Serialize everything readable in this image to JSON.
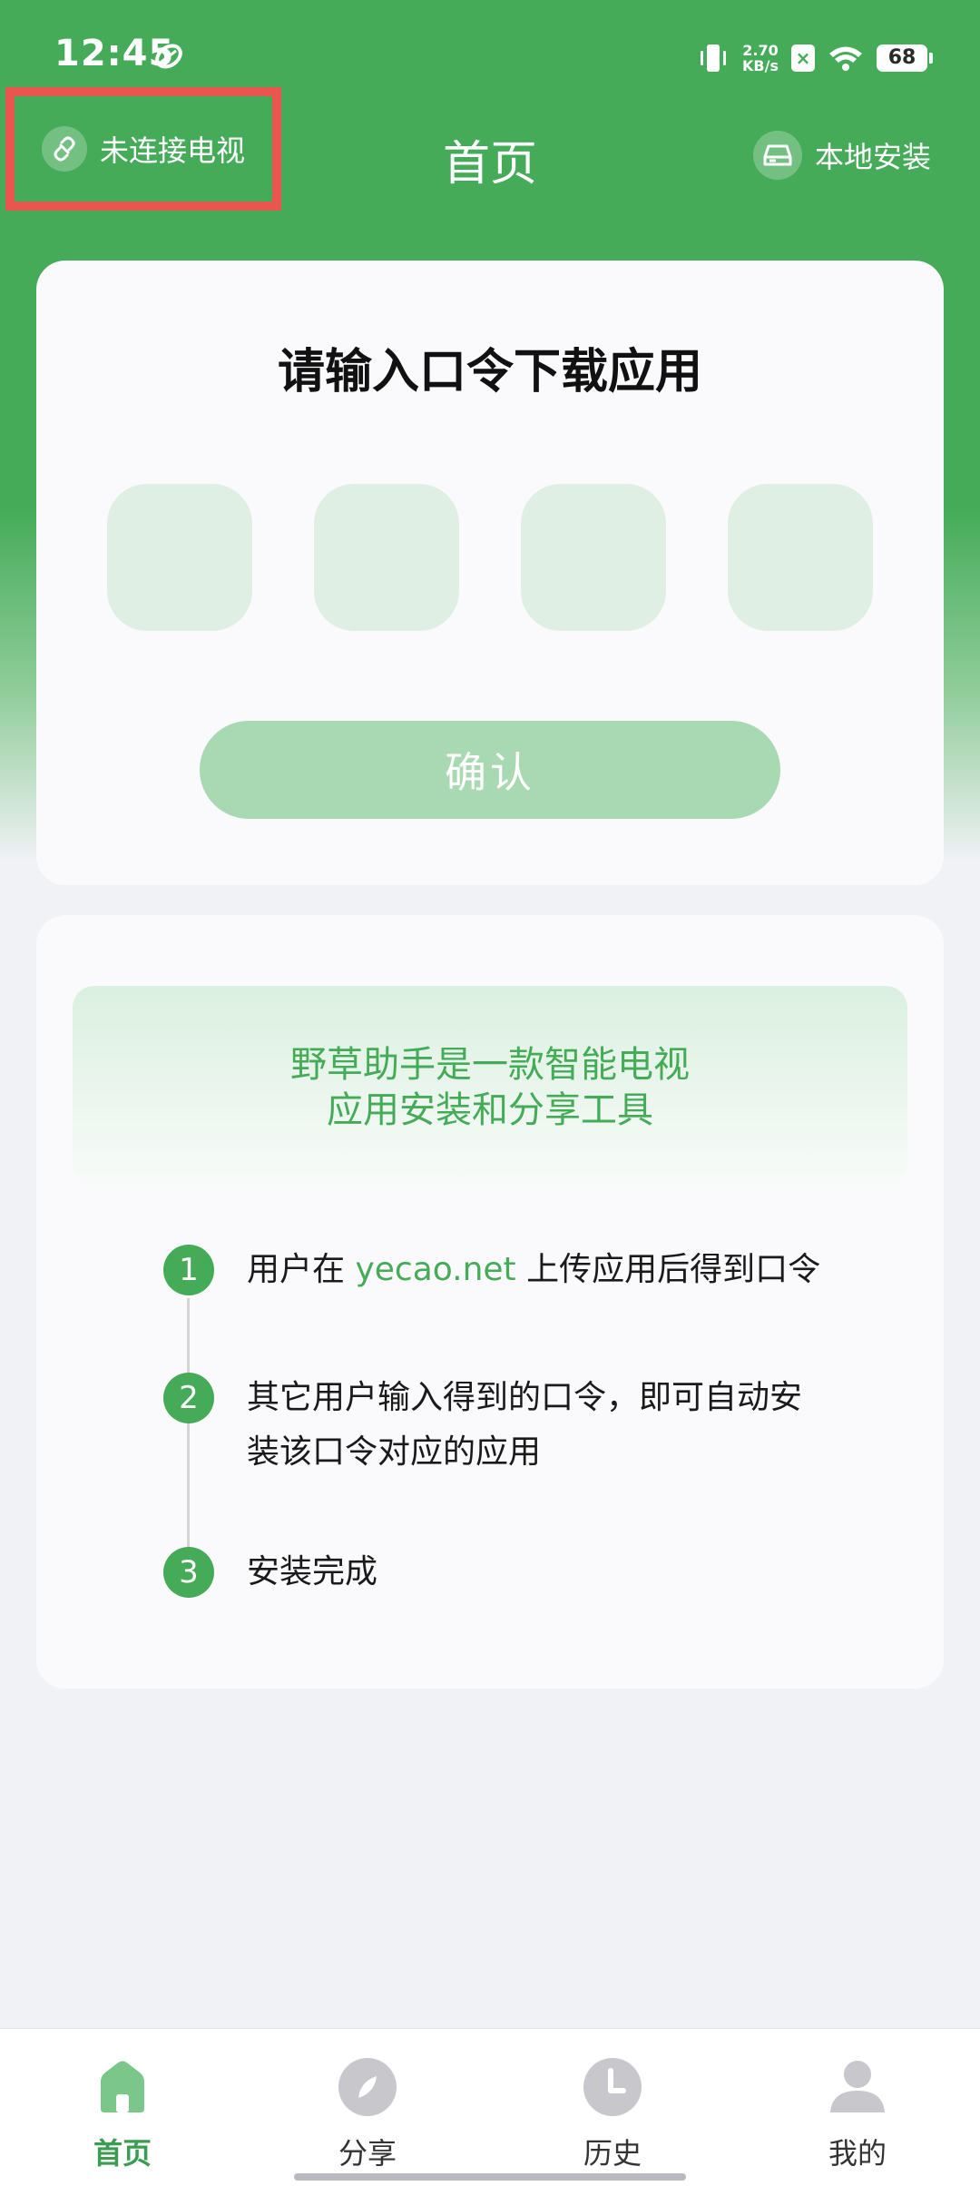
{
  "status_bar": {
    "time": "12:45",
    "net_speed_value": "2.70",
    "net_speed_unit": "KB/s",
    "battery": "68",
    "icons": [
      "leaf-icon",
      "vibrate-icon",
      "sim-disabled-icon",
      "wifi-icon",
      "battery-icon"
    ]
  },
  "header": {
    "tv_status_label": "未连接电视",
    "title": "首页",
    "local_install_label": "本地安装"
  },
  "code_card": {
    "heading": "请输入口令下载应用",
    "code_values": [
      "",
      "",
      "",
      ""
    ],
    "confirm_label": "确认"
  },
  "info_card": {
    "intro_line1": "野草助手是一款智能电视",
    "intro_line2": "应用安装和分享工具",
    "steps": [
      {
        "num": "1",
        "text_before": "用户在 ",
        "highlight": "yecao.net",
        "text_after": " 上传应用后得到口令"
      },
      {
        "num": "2",
        "line1": "其它用户输入得到的口令，即可自动安",
        "line2": "装该口令对应的应用"
      },
      {
        "num": "3",
        "text": "安装完成"
      }
    ]
  },
  "bottom_nav": {
    "items": [
      {
        "label": "首页",
        "icon": "home-icon",
        "active": true
      },
      {
        "label": "分享",
        "icon": "share-icon",
        "active": false
      },
      {
        "label": "历史",
        "icon": "history-icon",
        "active": false
      },
      {
        "label": "我的",
        "icon": "profile-icon",
        "active": false
      }
    ]
  },
  "colors": {
    "primary_green": "#45ab59",
    "code_box_bg": "#e0efe3",
    "confirm_disabled": "#a9d9b2",
    "highlight_border": "#e9564f"
  }
}
